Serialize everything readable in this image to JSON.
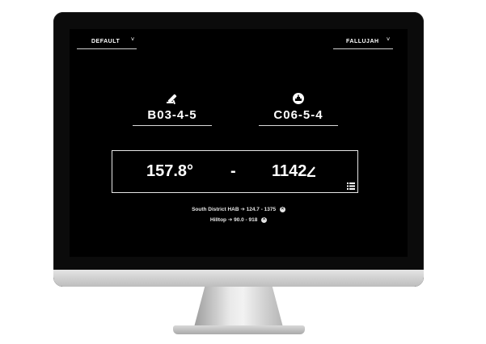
{
  "header": {
    "preset_dropdown": {
      "value": "DEFAULT",
      "caret": "˅"
    },
    "map_dropdown": {
      "value": "FALLUJAH",
      "caret": "˅"
    }
  },
  "units": {
    "mortar": {
      "icon": "mortar-icon",
      "grid": "B03-4-5"
    },
    "target": {
      "icon": "target-icon",
      "grid": "C06-5-4"
    }
  },
  "solution": {
    "azimuth": "157.8°",
    "separator": "-",
    "elevation": "1142",
    "elevation_suffix_icon": "angle-icon",
    "list_icon": "list-icon"
  },
  "secondary": [
    {
      "text": "South District HAB ➔ 124.7 - 1375",
      "remove": "✕"
    },
    {
      "text": "Hilltop ➔ 90.0 - 918",
      "remove": "✕"
    }
  ],
  "colors": {
    "screen": "#000000",
    "text": "#ffffff",
    "bezel": "#0b0b0b"
  }
}
